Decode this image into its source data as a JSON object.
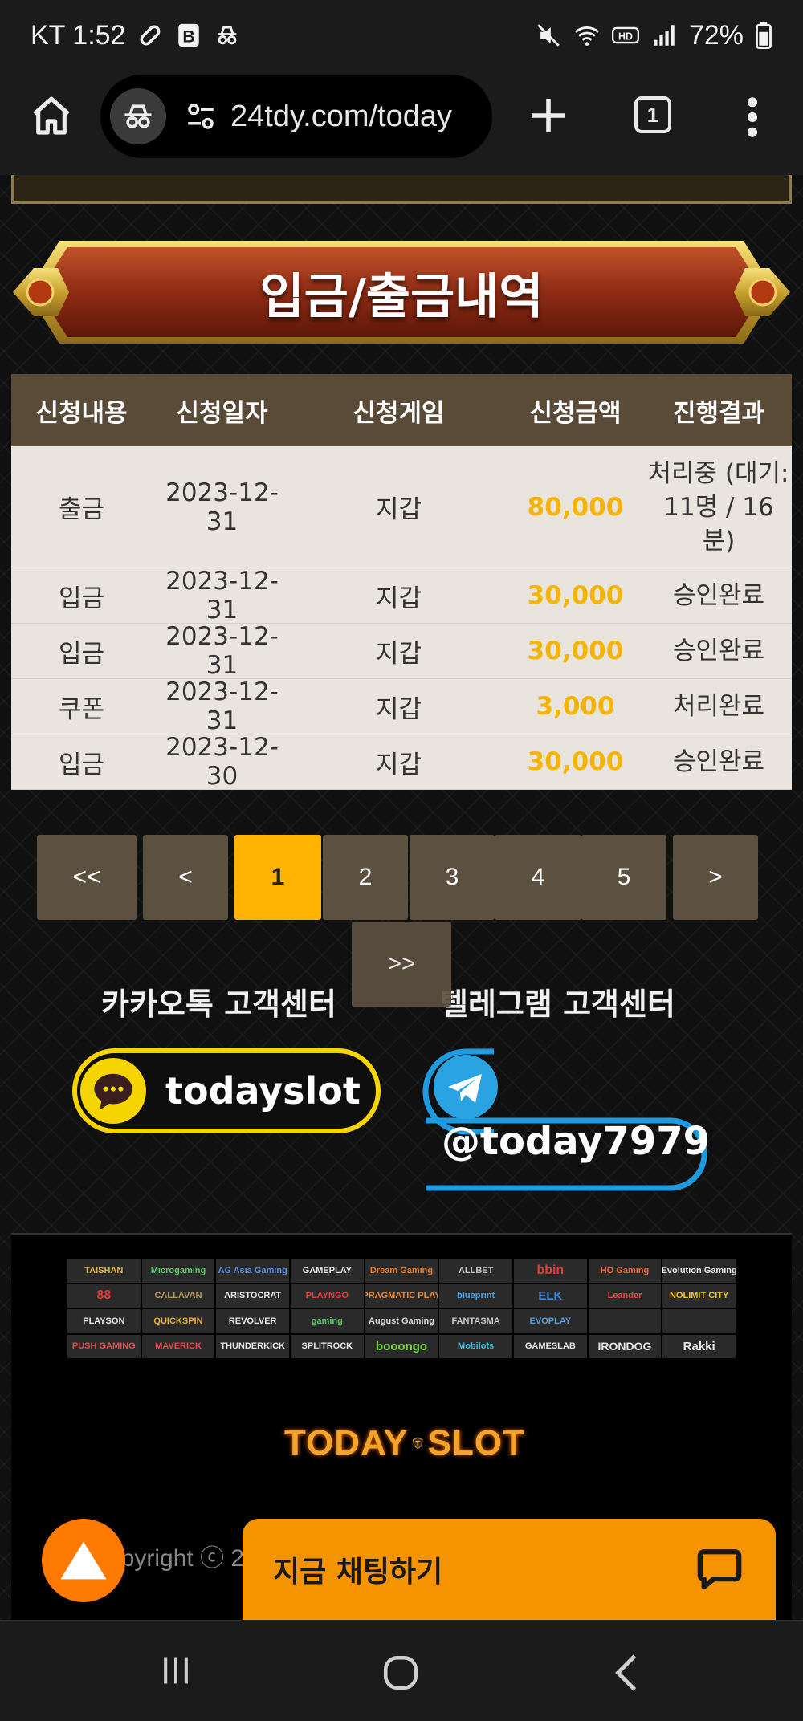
{
  "status_bar": {
    "carrier_time": "KT 1:52",
    "battery": "72%"
  },
  "browser": {
    "url": "24tdy.com/today",
    "tab_count": "1"
  },
  "page": {
    "title": "입금/출금내역",
    "table": {
      "headers": [
        "신청내용",
        "신청일자",
        "신청게임",
        "신청금액",
        "진행결과"
      ],
      "rows": [
        {
          "type": "출금",
          "date": "2023-12-31",
          "game": "지갑",
          "amount": "80,000",
          "result_line1": "처리중 (대기:",
          "result_line2": "11명 / 16",
          "result_line3": "분)"
        },
        {
          "type": "입금",
          "date": "2023-12-31",
          "game": "지갑",
          "amount": "30,000",
          "result": "승인완료"
        },
        {
          "type": "입금",
          "date": "2023-12-31",
          "game": "지갑",
          "amount": "30,000",
          "result": "승인완료"
        },
        {
          "type": "쿠폰",
          "date": "2023-12-31",
          "game": "지갑",
          "amount": "3,000",
          "result": "처리완료"
        },
        {
          "type": "입금",
          "date": "2023-12-30",
          "game": "지갑",
          "amount": "30,000",
          "result": "승인완료"
        }
      ]
    },
    "pagination": {
      "first": "<<",
      "prev": "<",
      "pages": [
        "1",
        "2",
        "3",
        "4",
        "5"
      ],
      "current": "1",
      "next": ">",
      "last": ">>"
    },
    "support": {
      "kakao_title": "카카오톡 고객센터",
      "kakao_id": "todayslot",
      "telegram_title": "텔레그램 고객센터",
      "telegram_id": "@today7979"
    },
    "footer": {
      "providers": [
        "TAISHAN",
        "Microgaming",
        "AG Asia Gaming",
        "GAMEPLAY",
        "Dream Gaming",
        "ALLBET",
        "bbin",
        "HO Gaming",
        "Evolution Gaming",
        "88",
        "CALLAVAN",
        "ARISTOCRAT",
        "PLAYNGO",
        "PRAGMATIC PLAY",
        "blueprint",
        "ELK",
        "Leander",
        "NOLIMIT CITY",
        "PLAYSON",
        "QUICKSPIN",
        "REVOLVER",
        "gaming",
        "August Gaming",
        "FANTASMA",
        "EVOPLAY",
        "",
        "",
        "PUSH GAMING",
        "MAVERICK",
        "THUNDERKICK",
        "SPLITROCK",
        "booongo",
        "Mobilots",
        "GAMESLAB",
        "IRONDOG",
        "Rakki"
      ],
      "logo_left": "TODAY",
      "logo_right": "SLOT",
      "copyright": "opyright ⓒ 2"
    },
    "chat_button": "지금 채팅하기"
  },
  "colors": {
    "amount": "#f5b400",
    "header_bg": "#5a4a38",
    "active_page": "#ffb300",
    "kakao": "#f6d400",
    "telegram": "#1e9be0",
    "chat": "#f59400"
  }
}
